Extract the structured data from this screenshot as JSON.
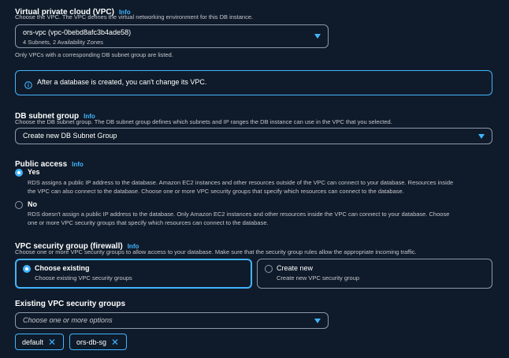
{
  "vpc": {
    "label": "Virtual private cloud (VPC)",
    "info": "Info",
    "description": "Choose the VPC. The VPC defines the virtual networking environment for this DB instance.",
    "selected_value": "ors-vpc (vpc-0bebd8afc3b4ade58)",
    "selected_sub": "4 Subnets, 2 Availability Zones",
    "footnote": "Only VPCs with a corresponding DB subnet group are listed."
  },
  "alert": {
    "icon": "info-circle-icon",
    "text": "After a database is created, you can't change its VPC."
  },
  "subnet": {
    "label": "DB subnet group",
    "info": "Info",
    "description": "Choose the DB subnet group. The DB subnet group defines which subnets and IP ranges the DB instance can use in the VPC that you selected.",
    "selected_value": "Create new DB Subnet Group"
  },
  "public_access": {
    "label": "Public access",
    "info": "Info",
    "options": [
      {
        "label": "Yes",
        "selected": true,
        "description_1": "RDS assigns a public IP address to the database. Amazon EC2 instances and other resources outside of the VPC can connect to your database. Resources inside",
        "description_2": "the VPC can also connect to the database. Choose one or more VPC security groups that specify which resources can connect to the database."
      },
      {
        "label": "No",
        "selected": false,
        "description_1": "RDS doesn't assign a public IP address to the database. Only Amazon EC2 instances and other resources inside the VPC can connect to your database. Choose",
        "description_2": "one or more VPC security groups that specify which resources can connect to the database."
      }
    ]
  },
  "security_group": {
    "label": "VPC security group (firewall)",
    "info": "Info",
    "description": "Choose one or more VPC security groups to allow access to your database. Make sure that the security group rules allow the appropriate incoming traffic.",
    "options": [
      {
        "label": "Choose existing",
        "sub": "Choose existing VPC security groups",
        "selected": true
      },
      {
        "label": "Create new",
        "sub": "Create new VPC security group",
        "selected": false
      }
    ]
  },
  "existing_groups": {
    "label": "Existing VPC security groups",
    "placeholder": "Choose one or more options",
    "tokens": [
      "default",
      "ors-db-sg"
    ]
  },
  "colors": {
    "background": "#0f1b2a",
    "accent": "#42b4ff",
    "border": "#8d99a8"
  }
}
